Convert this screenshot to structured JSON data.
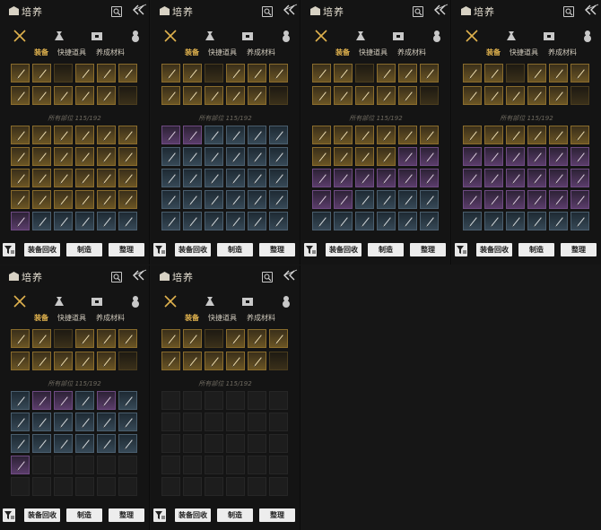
{
  "app": {
    "title": "培养",
    "tabs": [
      "装备",
      "快捷道具",
      "养成材料"
    ],
    "active_tab": 0,
    "slots_label": "所有部位 115/192",
    "footer": {
      "recycle_label": "装备回收",
      "craft_label": "制造",
      "sort_label": "整理"
    }
  },
  "colors": {
    "accent": "#e0b24e",
    "gold_slot": "#6b5524",
    "purple_slot": "#5a3c6a",
    "blue_slot": "#364856",
    "background": "#141414"
  },
  "icons": [
    "chest-icon",
    "search-icon",
    "collapse-arrows-icon",
    "crossed-swords-icon",
    "pouch-icon",
    "box-icon",
    "gourd-icon",
    "filter-icon"
  ],
  "panels": [
    {
      "inv": [
        "g",
        "g",
        "g",
        "g",
        "g",
        "g",
        "g",
        "g",
        "g",
        "g",
        "g",
        "g",
        "g",
        "g",
        "g",
        "g",
        "g",
        "g",
        "g",
        "g",
        "g",
        "g",
        "g",
        "g",
        "p",
        "b",
        "b",
        "b",
        "b",
        "b"
      ]
    },
    {
      "inv": [
        "p",
        "p",
        "b",
        "b",
        "b",
        "b",
        "b",
        "b",
        "b",
        "b",
        "b",
        "b",
        "b",
        "b",
        "b",
        "b",
        "b",
        "b",
        "b",
        "b",
        "b",
        "b",
        "b",
        "b",
        "b",
        "b",
        "b",
        "b",
        "b",
        "b"
      ]
    },
    {
      "inv": [
        "g",
        "g",
        "g",
        "g",
        "g",
        "g",
        "g",
        "g",
        "g",
        "g",
        "p",
        "p",
        "p",
        "p",
        "p",
        "p",
        "p",
        "p",
        "p",
        "p",
        "b",
        "b",
        "b",
        "b",
        "b",
        "b",
        "b",
        "b",
        "b",
        "b"
      ]
    },
    {
      "inv": [
        "g",
        "g",
        "g",
        "g",
        "g",
        "g",
        "p",
        "p",
        "p",
        "p",
        "p",
        "p",
        "p",
        "p",
        "p",
        "p",
        "p",
        "p",
        "p",
        "p",
        "p",
        "p",
        "p",
        "p",
        "b",
        "b",
        "b",
        "b",
        "b",
        "b"
      ]
    },
    {
      "inv": [
        "b",
        "p",
        "p",
        "b",
        "p",
        "b",
        "b",
        "b",
        "b",
        "b",
        "b",
        "b",
        "b",
        "b",
        "b",
        "b",
        "b",
        "b",
        "p",
        "e",
        "e",
        "e",
        "e",
        "e",
        "e",
        "e",
        "e",
        "e",
        "e",
        "e"
      ]
    },
    {
      "inv": [
        "e",
        "e",
        "e",
        "e",
        "e",
        "e",
        "e",
        "e",
        "e",
        "e",
        "e",
        "e",
        "e",
        "e",
        "e",
        "e",
        "e",
        "e",
        "e",
        "e",
        "e",
        "e",
        "e",
        "e",
        "e",
        "e",
        "e",
        "e",
        "e",
        "e"
      ]
    }
  ]
}
